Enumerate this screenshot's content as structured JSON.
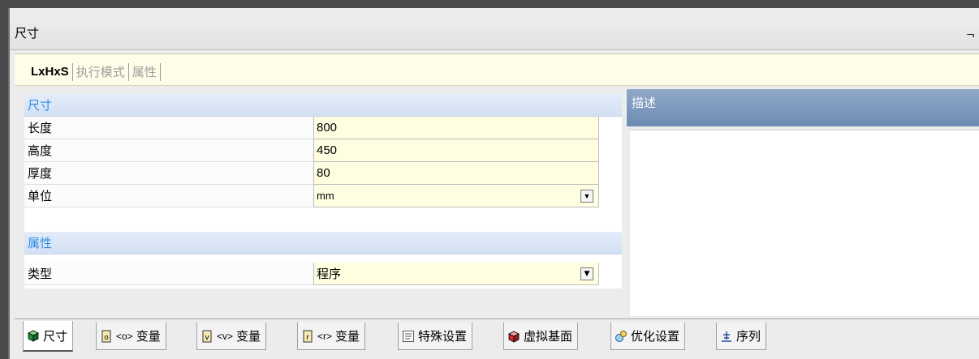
{
  "window": {
    "title": "尺寸",
    "pin_glyph": "ᆨ"
  },
  "top_tabs": [
    {
      "label": "LxHxS",
      "active": true
    },
    {
      "label": "执行模式",
      "active": false
    },
    {
      "label": "属性",
      "active": false
    }
  ],
  "sections": {
    "dimensions": {
      "label": "尺寸",
      "rows": [
        {
          "label": "长度",
          "value": "800"
        },
        {
          "label": "高度",
          "value": "450"
        },
        {
          "label": "厚度",
          "value": "80"
        },
        {
          "label": "单位",
          "value": "mm"
        }
      ]
    },
    "attributes": {
      "label": "属性",
      "rows": [
        {
          "label": "类型",
          "value": "程序"
        }
      ]
    }
  },
  "description": {
    "title": "描述"
  },
  "bottom_tabs": [
    {
      "label": "尺寸",
      "icon": "cube-green-icon"
    },
    {
      "prefix": "<o>",
      "label": "变量",
      "icon": "variable-o-icon"
    },
    {
      "prefix": "<v>",
      "label": "变量",
      "icon": "variable-v-icon"
    },
    {
      "prefix": "<r>",
      "label": "变量",
      "icon": "variable-r-icon"
    },
    {
      "label": "特殊设置",
      "icon": "settings-list-icon"
    },
    {
      "label": "虚拟基面",
      "icon": "cube-red-icon"
    },
    {
      "label": "优化设置",
      "icon": "optimize-icon"
    },
    {
      "label": "序列",
      "icon": "sequence-icon"
    }
  ]
}
